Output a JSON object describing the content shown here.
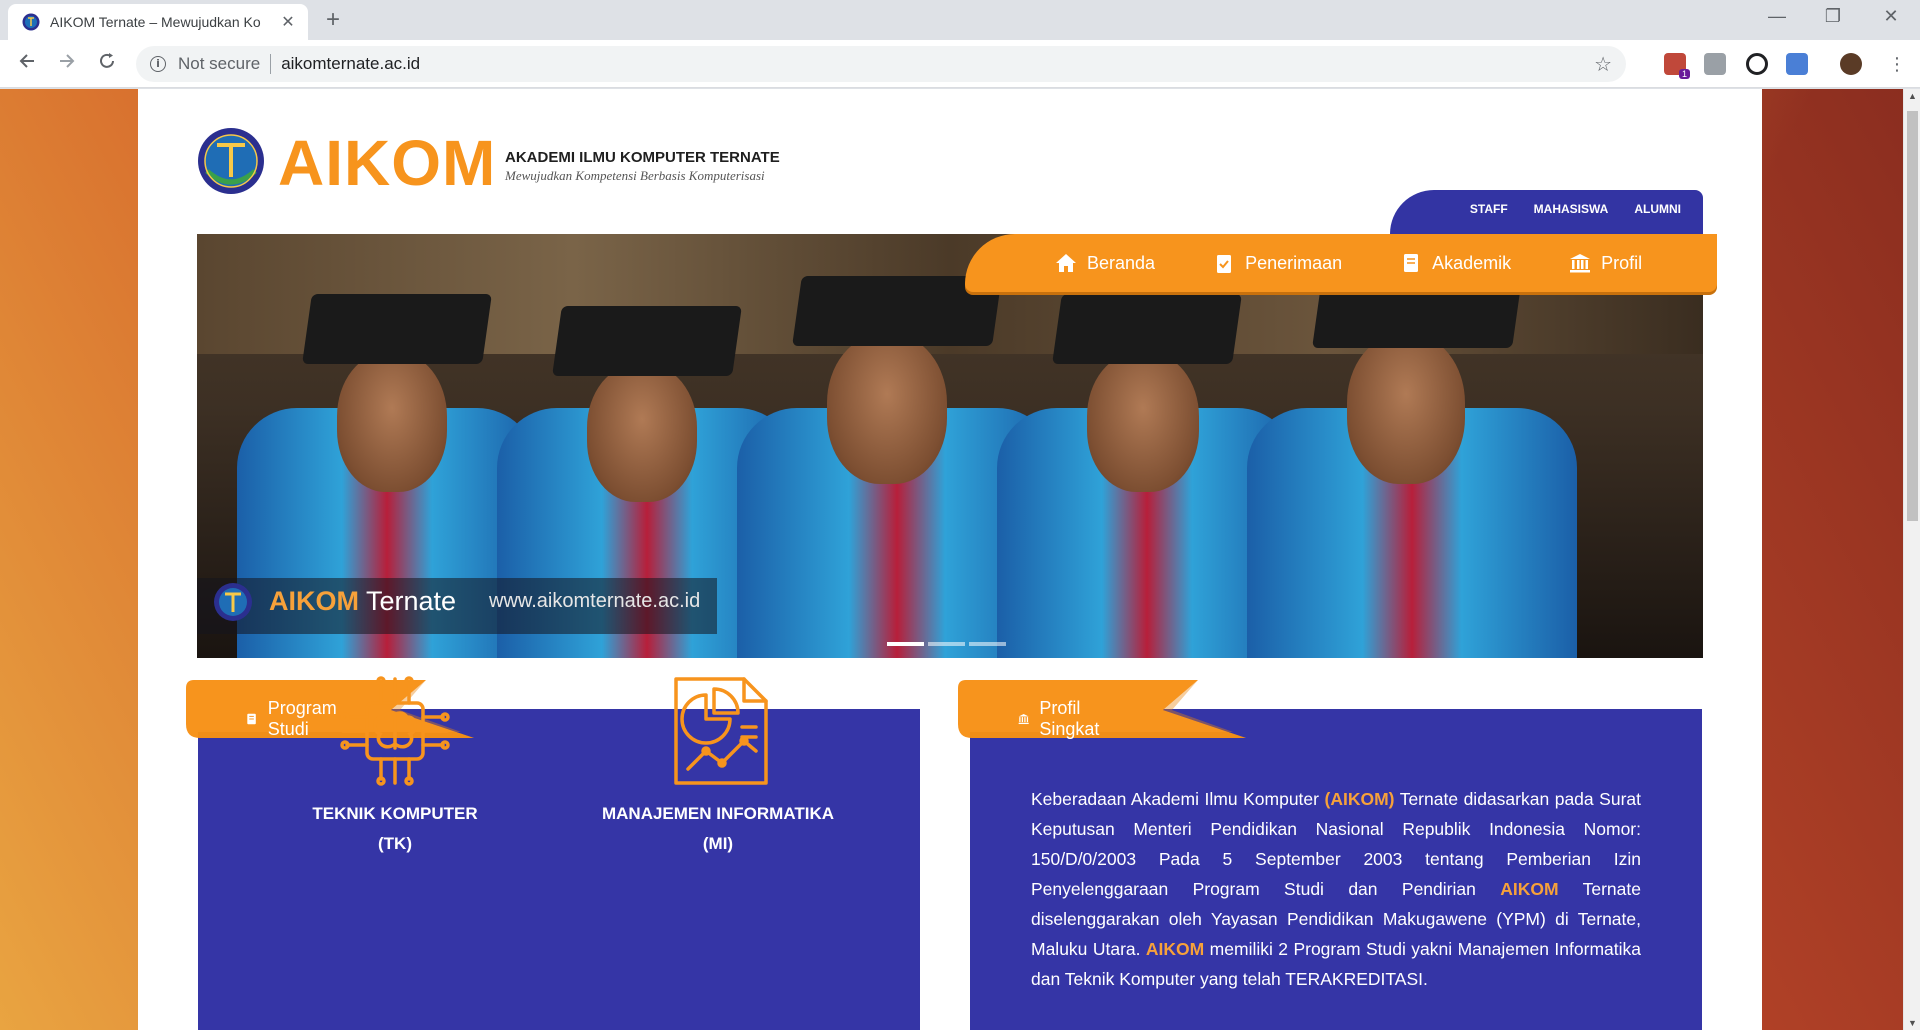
{
  "browser": {
    "tab_title": "AIKOM Ternate – Mewujudkan Ko",
    "close_glyph": "✕",
    "new_tab_glyph": "+",
    "not_secure": "Not secure",
    "url": "aikomternate.ac.id",
    "ext_badge": "1",
    "window": {
      "minimize": "—",
      "restore": "❐",
      "close": "✕"
    }
  },
  "site": {
    "brand": "AIKOM",
    "institution": "AKADEMI ILMU KOMPUTER TERNATE",
    "tagline": "Mewujudkan Kompetensi Berbasis Komputerisasi",
    "top_nav": [
      "STAFF",
      "MAHASISWA",
      "ALUMNI"
    ],
    "main_nav": [
      {
        "label": "Beranda",
        "icon": "home-icon"
      },
      {
        "label": "Penerimaan",
        "icon": "clipboard-check-icon"
      },
      {
        "label": "Akademik",
        "icon": "book-icon"
      },
      {
        "label": "Profil",
        "icon": "institution-icon"
      }
    ],
    "hero": {
      "brand_bold": "AIKOM",
      "brand_light": "Ternate",
      "url": "www.aikomternate.ac.id",
      "slides": 3,
      "active_slide": 1
    },
    "program_studi": {
      "title": "Program Studi",
      "items": [
        {
          "name": "TEKNIK KOMPUTER",
          "abbr": "(TK)",
          "icon": "circuit-brain-icon"
        },
        {
          "name": "MANAJEMEN INFORMATIKA",
          "abbr": "(MI)",
          "icon": "document-chart-icon"
        }
      ]
    },
    "profil_singkat": {
      "title": "Profil Singkat",
      "p1": "Keberadaan Akademi Ilmu Komputer ",
      "h1": "(AIKOM)",
      "p2": " Ternate didasarkan pada Surat Keputusan Menteri Pendidikan Nasional Republik Indonesia Nomor: 150/D/0/2003 Pada 5 September 2003 tentang Pemberian Izin Penyelenggaraan Program Studi dan Pendirian ",
      "h2": "AIKOM",
      "p3": " Ternate diselenggarakan oleh Yayasan Pendidikan Makugawene (YPM) di Ternate, Maluku Utara. ",
      "h3": "AIKOM",
      "p4": " memiliki 2 Program Studi yakni Manajemen Informatika dan Teknik Komputer yang telah TERAKREDITASI."
    }
  },
  "colors": {
    "orange": "#f7941d",
    "indigo": "#3535a6",
    "white": "#ffffff"
  }
}
